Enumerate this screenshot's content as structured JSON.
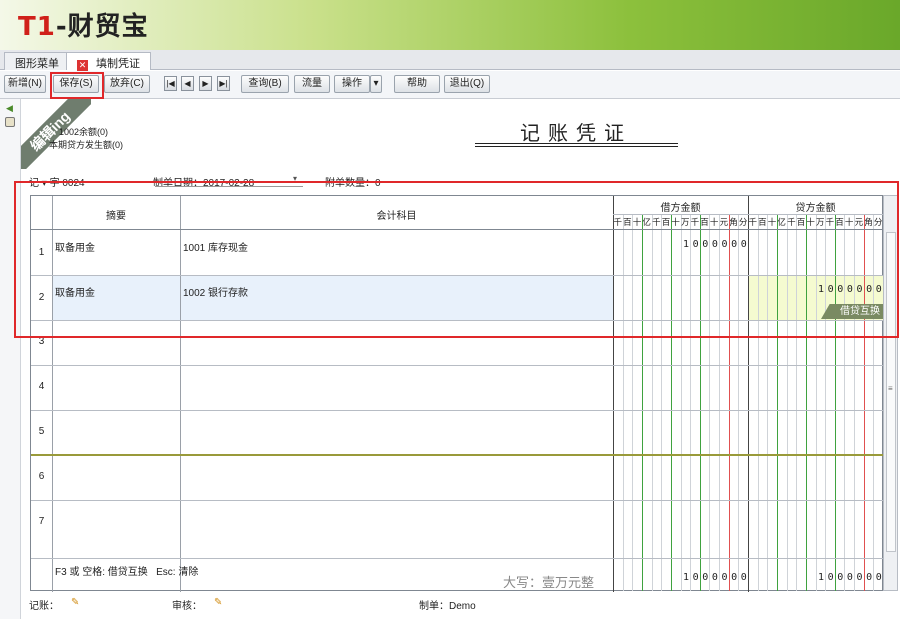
{
  "header": {
    "logo_prefix": "T1",
    "logo_rest": "-财贸宝"
  },
  "tabs": [
    {
      "label": "图形菜单"
    },
    {
      "label": "填制凭证"
    }
  ],
  "toolbar": {
    "new_label": "新增(N)",
    "save_label": "保存(S)",
    "discard_label": "放弃(C)",
    "query_label": "查询(B)",
    "flow_label": "流量",
    "operate_label": "操作",
    "help_label": "帮助",
    "exit_label": "退出(Q)"
  },
  "ribbon": {
    "label": "编辑ing"
  },
  "info": {
    "balance": "1002余额(0)",
    "period_total": "本期贷方发生额(0)"
  },
  "voucher": {
    "title": "记账凭证",
    "voucher_no": "记 ▾ 字 0024",
    "date": "制单日期：2017-02-28",
    "attachments": "附单数量：0"
  },
  "table": {
    "headers": {
      "summary": "摘要",
      "account": "会计科目",
      "debit": "借方金额",
      "credit": "贷方金额"
    },
    "digit_labels": [
      "千",
      "百",
      "十",
      "亿",
      "千",
      "百",
      "十",
      "万",
      "千",
      "百",
      "十",
      "元",
      "角",
      "分"
    ],
    "rows": [
      {
        "no": "1",
        "summary": "取备用金",
        "account": "1001  库存现金",
        "debit": "1000000",
        "credit": ""
      },
      {
        "no": "2",
        "summary": "取备用金",
        "account": "1002  银行存款",
        "debit": "",
        "credit": "1000000"
      },
      {
        "no": "3",
        "summary": "",
        "account": "",
        "debit": "",
        "credit": ""
      },
      {
        "no": "4",
        "summary": "",
        "account": "",
        "debit": "",
        "credit": ""
      },
      {
        "no": "5",
        "summary": "",
        "account": "",
        "debit": "",
        "credit": ""
      },
      {
        "no": "6",
        "summary": "",
        "account": "",
        "debit": "",
        "credit": ""
      },
      {
        "no": "7",
        "summary": "",
        "account": "",
        "debit": "",
        "credit": ""
      }
    ],
    "swap_label": "借贷互换",
    "hint": "F3 或 空格: 借贷互换   Esc: 清除",
    "total_words": "大写：壹万元整",
    "debit_total": "1000000",
    "credit_total": "1000000"
  },
  "footer": {
    "bookkeeper": "记账：",
    "reviewer": "审核：",
    "maker": "制单：Demo"
  },
  "colors": {
    "highlight_red": "#e0282a",
    "grid_green": "#3fa23f",
    "grid_red": "#e05050",
    "credit_cell_bg": "#f5fbd0"
  }
}
